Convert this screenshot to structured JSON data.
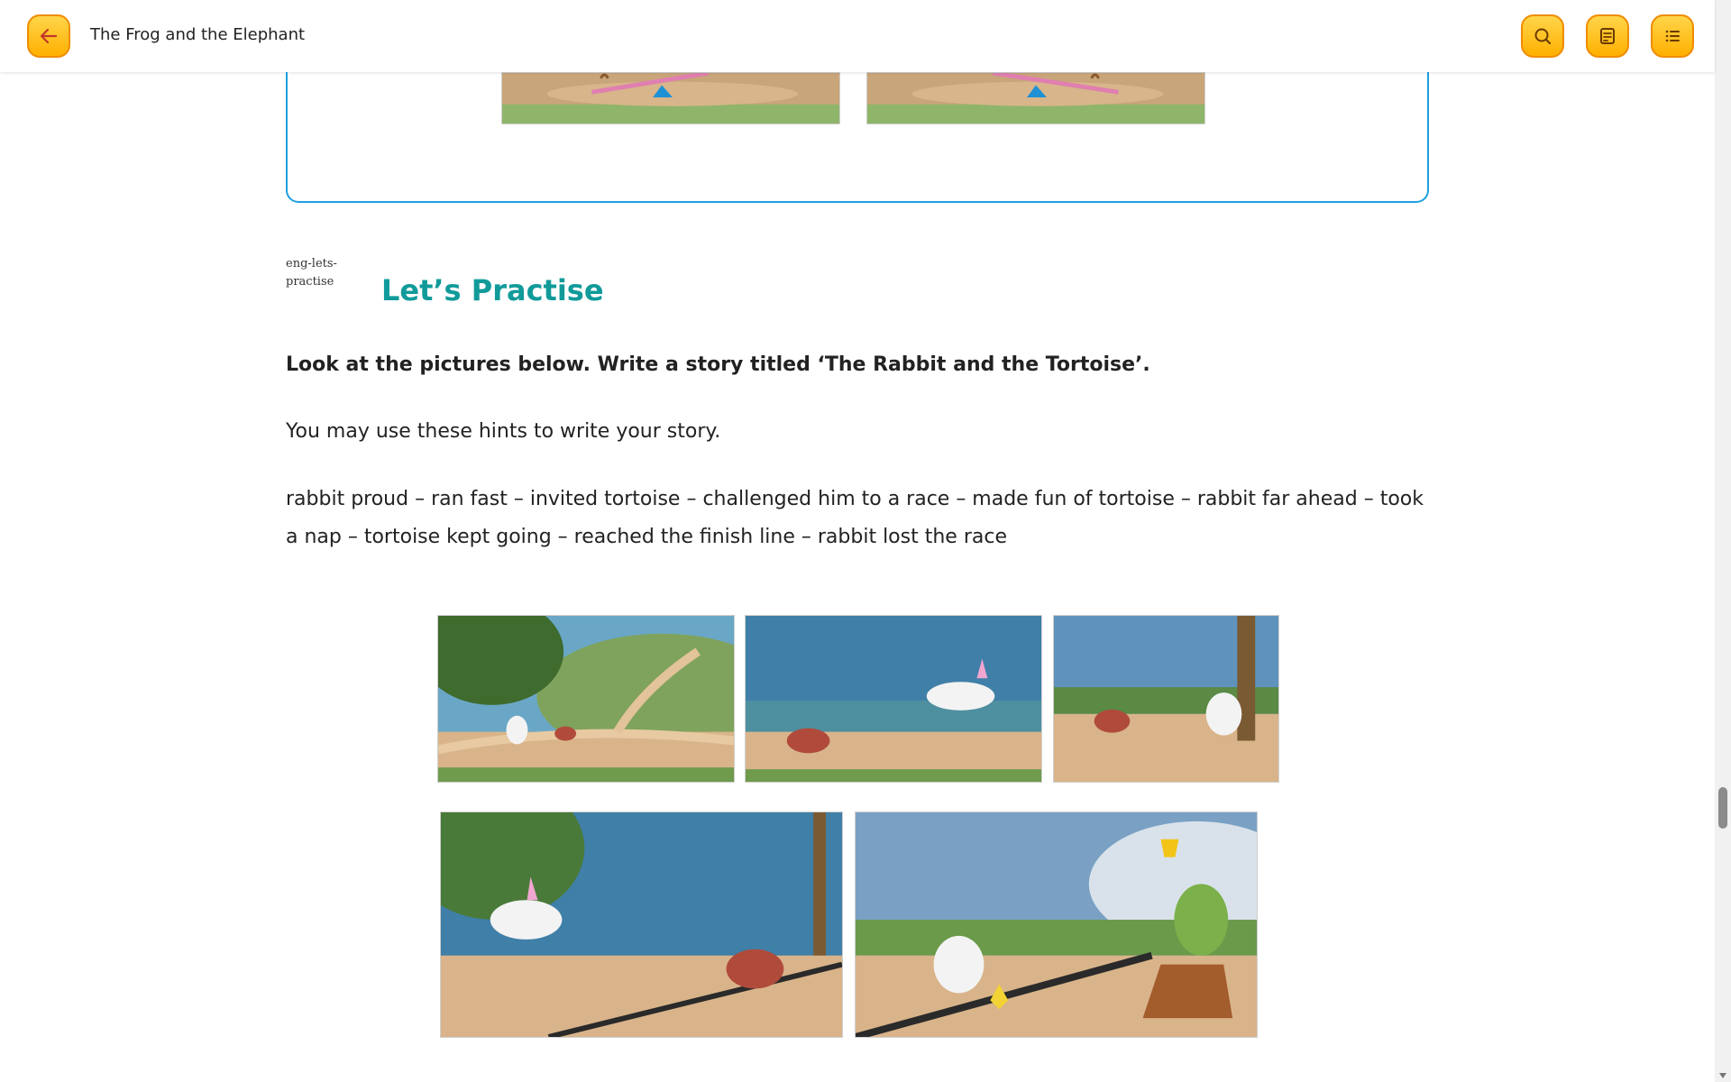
{
  "header": {
    "title": "The Frog and the Elephant"
  },
  "section": {
    "heading": "Let’s Practise",
    "heading_image_alt": "eng-lets-practise",
    "instruction": "Look at the pictures below. Write a story titled ‘The Rabbit and the Tortoise’.",
    "hint_intro": "You may use these hints to write your story.",
    "hints": "rabbit proud – ran fast – invited tortoise – challenged him to a race – made fun of tortoise – rabbit far ahead – took a nap – tortoise kept going – reached the finish line – rabbit lost the race"
  },
  "icons": {
    "back": "arrow-left-icon",
    "search": "search-icon",
    "notes": "notes-icon",
    "menu": "list-icon"
  },
  "colors": {
    "accent": "#ffb000",
    "accent_border": "#f08c00",
    "heading": "#119a9a",
    "box_border": "#1ea0e0"
  }
}
